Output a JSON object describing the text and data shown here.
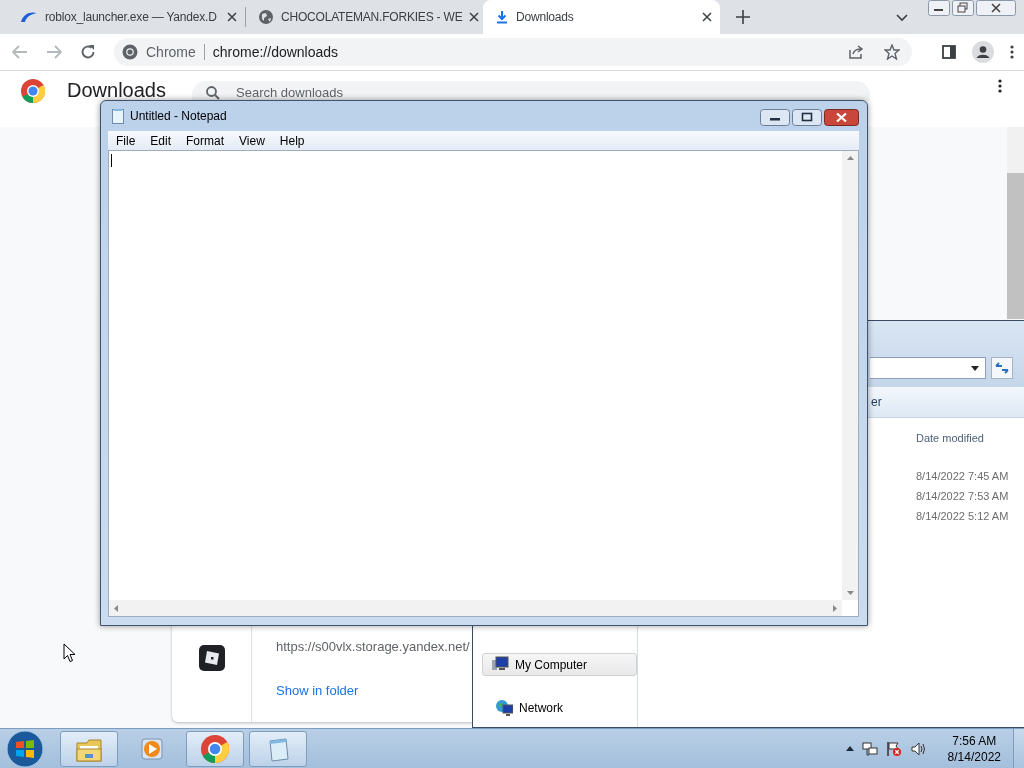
{
  "browser": {
    "tabs": [
      {
        "kind": "yandex",
        "title": "roblox_launcher.exe — Yandex.D",
        "selected": false
      },
      {
        "kind": "globe",
        "title": "CHOCOLATEMAN.FORKIES - WE",
        "selected": false
      },
      {
        "kind": "download",
        "title": "Downloads",
        "selected": true
      }
    ],
    "omnibox": {
      "label": "Chrome",
      "url": "chrome://downloads"
    },
    "page": {
      "title": "Downloads",
      "search": {
        "placeholder": "Search downloads"
      },
      "download": {
        "url": "https://s00vlx.storage.yandex.net/",
        "action": "Show in folder"
      }
    }
  },
  "explorer": {
    "toolbar_text": "er",
    "columns": [
      "Date modified"
    ],
    "rows": [
      {
        "date_modified": "8/14/2022 7:45 AM"
      },
      {
        "date_modified": "8/14/2022 7:53 AM"
      },
      {
        "date_modified": "8/14/2022 5:12 AM"
      }
    ],
    "nav_items": [
      {
        "kind": "computer",
        "label": "My Computer",
        "selected": true
      },
      {
        "kind": "network",
        "label": "Network",
        "selected": false
      }
    ]
  },
  "notepad": {
    "title": "Untitled - Notepad",
    "menu": [
      "File",
      "Edit",
      "Format",
      "View",
      "Help"
    ]
  },
  "taskbar": {
    "apps": [
      {
        "kind": "explorer"
      },
      {
        "kind": "media"
      },
      {
        "kind": "chrome"
      },
      {
        "kind": "notepad"
      }
    ],
    "clock": {
      "time": "7:56 AM",
      "date": "8/14/2022"
    }
  }
}
